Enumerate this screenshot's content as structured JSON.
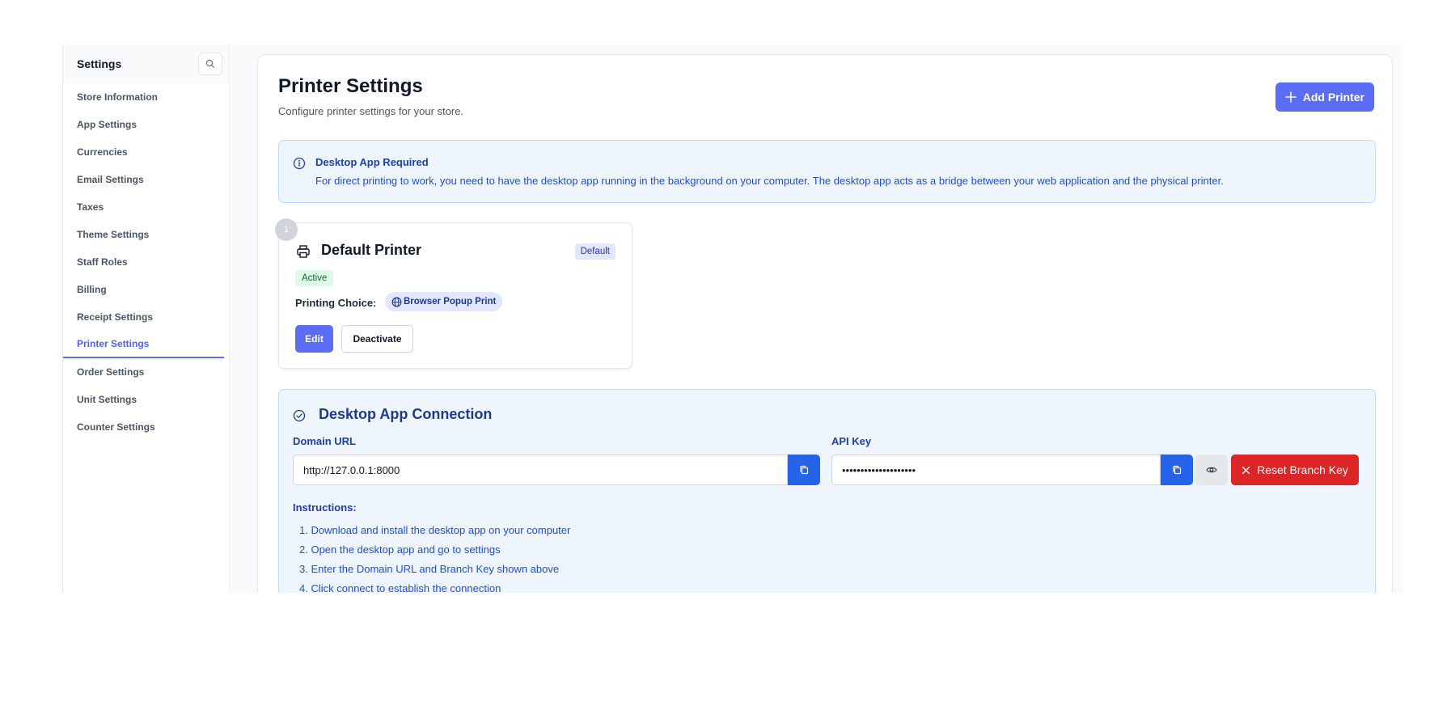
{
  "sidebar": {
    "title": "Settings",
    "items": [
      {
        "label": "Store Information"
      },
      {
        "label": "App Settings"
      },
      {
        "label": "Currencies"
      },
      {
        "label": "Email Settings"
      },
      {
        "label": "Taxes"
      },
      {
        "label": "Theme Settings"
      },
      {
        "label": "Staff Roles"
      },
      {
        "label": "Billing"
      },
      {
        "label": "Receipt Settings"
      },
      {
        "label": "Printer Settings",
        "active": true
      },
      {
        "label": "Order Settings"
      },
      {
        "label": "Unit Settings"
      },
      {
        "label": "Counter Settings"
      }
    ]
  },
  "page": {
    "title": "Printer Settings",
    "subtitle": "Configure printer settings for your store.",
    "add_button": "Add Printer"
  },
  "notice": {
    "title": "Desktop App Required",
    "text": "For direct printing to work, you need to have the desktop app running in the background on your computer. The desktop app acts as a bridge between your web application and the physical printer."
  },
  "printer": {
    "number": "1",
    "name": "Default Printer",
    "default_badge": "Default",
    "status": "Active",
    "choice_label": "Printing Choice:",
    "choice_value": "Browser Popup Print",
    "edit_label": "Edit",
    "deactivate_label": "Deactivate"
  },
  "connection": {
    "title": "Desktop App Connection",
    "domain_label": "Domain URL",
    "domain_value": "http://127.0.0.1:8000",
    "api_label": "API Key",
    "api_value": "••••••••••••••••••••",
    "reset_label": "Reset Branch Key",
    "instructions_title": "Instructions:",
    "instructions": [
      "1. Download and install the desktop app on your computer",
      "2. Open the desktop app and go to settings",
      "3. Enter the Domain URL and Branch Key shown above",
      "4. Click connect to establish the connection"
    ]
  },
  "colors": {
    "accent": "#5b6cf5",
    "info_bg": "#eef5ff",
    "danger": "#dc2626",
    "copy": "#2563eb"
  }
}
